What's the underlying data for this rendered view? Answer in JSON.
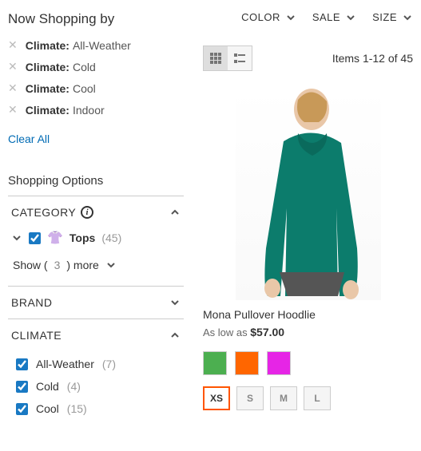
{
  "sidebar": {
    "now_shopping_title": "Now Shopping by",
    "active_filters": [
      {
        "label": "Climate:",
        "value": "All-Weather"
      },
      {
        "label": "Climate:",
        "value": "Cold"
      },
      {
        "label": "Climate:",
        "value": "Cool"
      },
      {
        "label": "Climate:",
        "value": "Indoor"
      }
    ],
    "clear_all": "Clear All",
    "shopping_options": "Shopping Options",
    "facets": {
      "category": {
        "title": "CATEGORY",
        "item_name": "Tops",
        "item_count": "(45)",
        "show_more_prefix": "Show (",
        "show_more_count": "3",
        "show_more_suffix": ") more"
      },
      "brand": {
        "title": "BRAND"
      },
      "climate": {
        "title": "CLIMATE",
        "options": [
          {
            "label": "All-Weather",
            "count": "(7)"
          },
          {
            "label": "Cold",
            "count": "(4)"
          },
          {
            "label": "Cool",
            "count": "(15)"
          }
        ]
      }
    }
  },
  "topbar": {
    "color": "COLOR",
    "sale": "SALE",
    "size": "SIZE"
  },
  "toolbar": {
    "items_count": "Items 1-12 of 45"
  },
  "product": {
    "name": "Mona Pullover Hoodlie",
    "price_label": "As low as ",
    "price": "$57.00",
    "swatches": [
      {
        "color": "#4CAF50"
      },
      {
        "color": "#ff6600"
      },
      {
        "color": "#e625e6"
      }
    ],
    "sizes": [
      "XS",
      "S",
      "M",
      "L"
    ]
  }
}
